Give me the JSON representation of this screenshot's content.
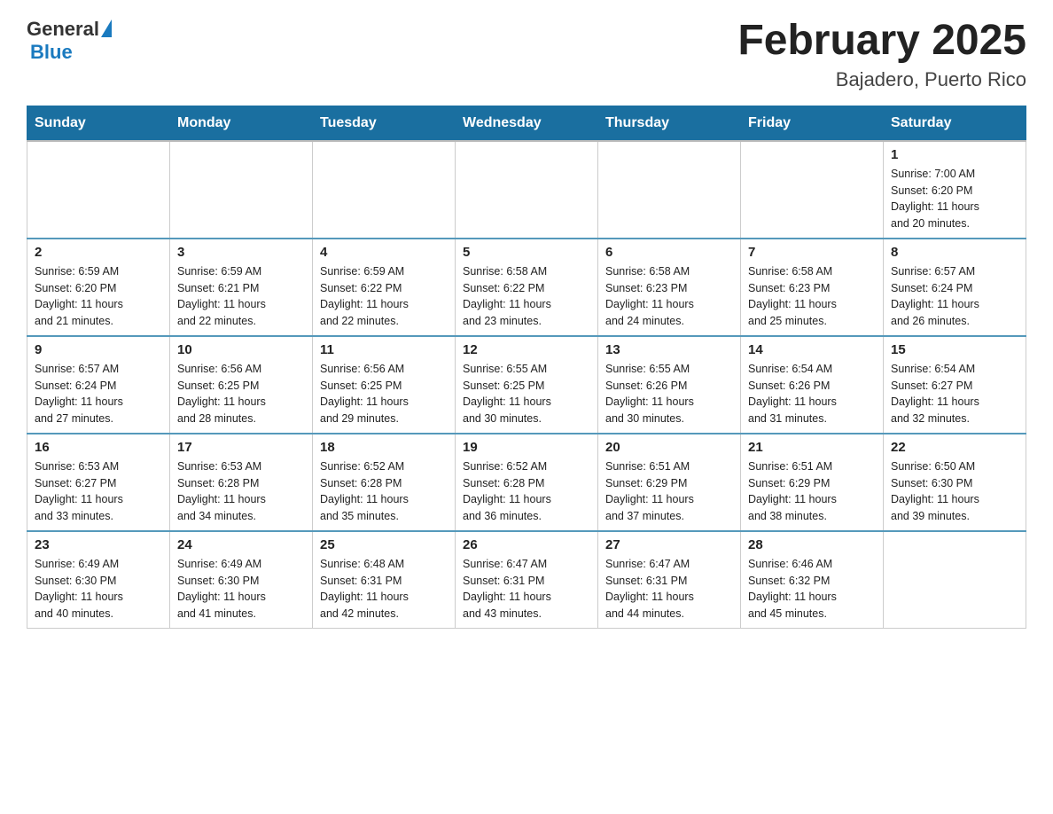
{
  "logo": {
    "general": "General",
    "blue": "Blue"
  },
  "title": "February 2025",
  "subtitle": "Bajadero, Puerto Rico",
  "days_header": [
    "Sunday",
    "Monday",
    "Tuesday",
    "Wednesday",
    "Thursday",
    "Friday",
    "Saturday"
  ],
  "weeks": [
    [
      {
        "day": "",
        "info": ""
      },
      {
        "day": "",
        "info": ""
      },
      {
        "day": "",
        "info": ""
      },
      {
        "day": "",
        "info": ""
      },
      {
        "day": "",
        "info": ""
      },
      {
        "day": "",
        "info": ""
      },
      {
        "day": "1",
        "info": "Sunrise: 7:00 AM\nSunset: 6:20 PM\nDaylight: 11 hours\nand 20 minutes."
      }
    ],
    [
      {
        "day": "2",
        "info": "Sunrise: 6:59 AM\nSunset: 6:20 PM\nDaylight: 11 hours\nand 21 minutes."
      },
      {
        "day": "3",
        "info": "Sunrise: 6:59 AM\nSunset: 6:21 PM\nDaylight: 11 hours\nand 22 minutes."
      },
      {
        "day": "4",
        "info": "Sunrise: 6:59 AM\nSunset: 6:22 PM\nDaylight: 11 hours\nand 22 minutes."
      },
      {
        "day": "5",
        "info": "Sunrise: 6:58 AM\nSunset: 6:22 PM\nDaylight: 11 hours\nand 23 minutes."
      },
      {
        "day": "6",
        "info": "Sunrise: 6:58 AM\nSunset: 6:23 PM\nDaylight: 11 hours\nand 24 minutes."
      },
      {
        "day": "7",
        "info": "Sunrise: 6:58 AM\nSunset: 6:23 PM\nDaylight: 11 hours\nand 25 minutes."
      },
      {
        "day": "8",
        "info": "Sunrise: 6:57 AM\nSunset: 6:24 PM\nDaylight: 11 hours\nand 26 minutes."
      }
    ],
    [
      {
        "day": "9",
        "info": "Sunrise: 6:57 AM\nSunset: 6:24 PM\nDaylight: 11 hours\nand 27 minutes."
      },
      {
        "day": "10",
        "info": "Sunrise: 6:56 AM\nSunset: 6:25 PM\nDaylight: 11 hours\nand 28 minutes."
      },
      {
        "day": "11",
        "info": "Sunrise: 6:56 AM\nSunset: 6:25 PM\nDaylight: 11 hours\nand 29 minutes."
      },
      {
        "day": "12",
        "info": "Sunrise: 6:55 AM\nSunset: 6:25 PM\nDaylight: 11 hours\nand 30 minutes."
      },
      {
        "day": "13",
        "info": "Sunrise: 6:55 AM\nSunset: 6:26 PM\nDaylight: 11 hours\nand 30 minutes."
      },
      {
        "day": "14",
        "info": "Sunrise: 6:54 AM\nSunset: 6:26 PM\nDaylight: 11 hours\nand 31 minutes."
      },
      {
        "day": "15",
        "info": "Sunrise: 6:54 AM\nSunset: 6:27 PM\nDaylight: 11 hours\nand 32 minutes."
      }
    ],
    [
      {
        "day": "16",
        "info": "Sunrise: 6:53 AM\nSunset: 6:27 PM\nDaylight: 11 hours\nand 33 minutes."
      },
      {
        "day": "17",
        "info": "Sunrise: 6:53 AM\nSunset: 6:28 PM\nDaylight: 11 hours\nand 34 minutes."
      },
      {
        "day": "18",
        "info": "Sunrise: 6:52 AM\nSunset: 6:28 PM\nDaylight: 11 hours\nand 35 minutes."
      },
      {
        "day": "19",
        "info": "Sunrise: 6:52 AM\nSunset: 6:28 PM\nDaylight: 11 hours\nand 36 minutes."
      },
      {
        "day": "20",
        "info": "Sunrise: 6:51 AM\nSunset: 6:29 PM\nDaylight: 11 hours\nand 37 minutes."
      },
      {
        "day": "21",
        "info": "Sunrise: 6:51 AM\nSunset: 6:29 PM\nDaylight: 11 hours\nand 38 minutes."
      },
      {
        "day": "22",
        "info": "Sunrise: 6:50 AM\nSunset: 6:30 PM\nDaylight: 11 hours\nand 39 minutes."
      }
    ],
    [
      {
        "day": "23",
        "info": "Sunrise: 6:49 AM\nSunset: 6:30 PM\nDaylight: 11 hours\nand 40 minutes."
      },
      {
        "day": "24",
        "info": "Sunrise: 6:49 AM\nSunset: 6:30 PM\nDaylight: 11 hours\nand 41 minutes."
      },
      {
        "day": "25",
        "info": "Sunrise: 6:48 AM\nSunset: 6:31 PM\nDaylight: 11 hours\nand 42 minutes."
      },
      {
        "day": "26",
        "info": "Sunrise: 6:47 AM\nSunset: 6:31 PM\nDaylight: 11 hours\nand 43 minutes."
      },
      {
        "day": "27",
        "info": "Sunrise: 6:47 AM\nSunset: 6:31 PM\nDaylight: 11 hours\nand 44 minutes."
      },
      {
        "day": "28",
        "info": "Sunrise: 6:46 AM\nSunset: 6:32 PM\nDaylight: 11 hours\nand 45 minutes."
      },
      {
        "day": "",
        "info": ""
      }
    ]
  ]
}
